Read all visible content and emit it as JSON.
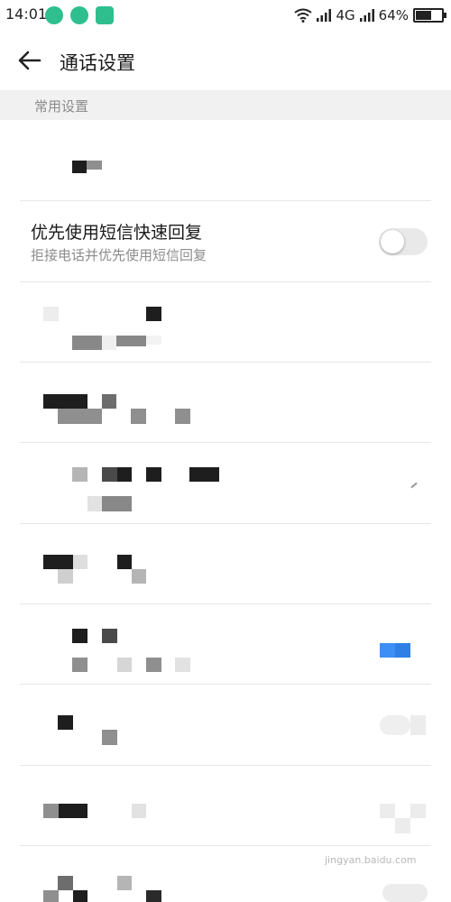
{
  "status_bar": {
    "time": "14:01",
    "network": "4G",
    "battery": "64%",
    "battery_level": 0.64,
    "icons": [
      "weibo-icon",
      "refresh-app-icon",
      "scan-app-icon",
      "wifi-icon",
      "signal-icon",
      "signal-icon",
      "battery-icon"
    ]
  },
  "header": {
    "title": "通话设置",
    "back_icon": "arrow-left-icon"
  },
  "section": {
    "label": "常用设置"
  },
  "settings": {
    "sms_quick_reply": {
      "title": "优先使用短信快速回复",
      "subtitle": "拒接电话并优先使用短信回复",
      "enabled": false
    }
  },
  "watermark": "jingyan.baidu.com",
  "colors": {
    "toggle_off": "#e9e9e9",
    "toggle_on": "#3d8ef5",
    "section_bg": "#f1f1f1",
    "notif_icon": "#2fbf8f"
  }
}
